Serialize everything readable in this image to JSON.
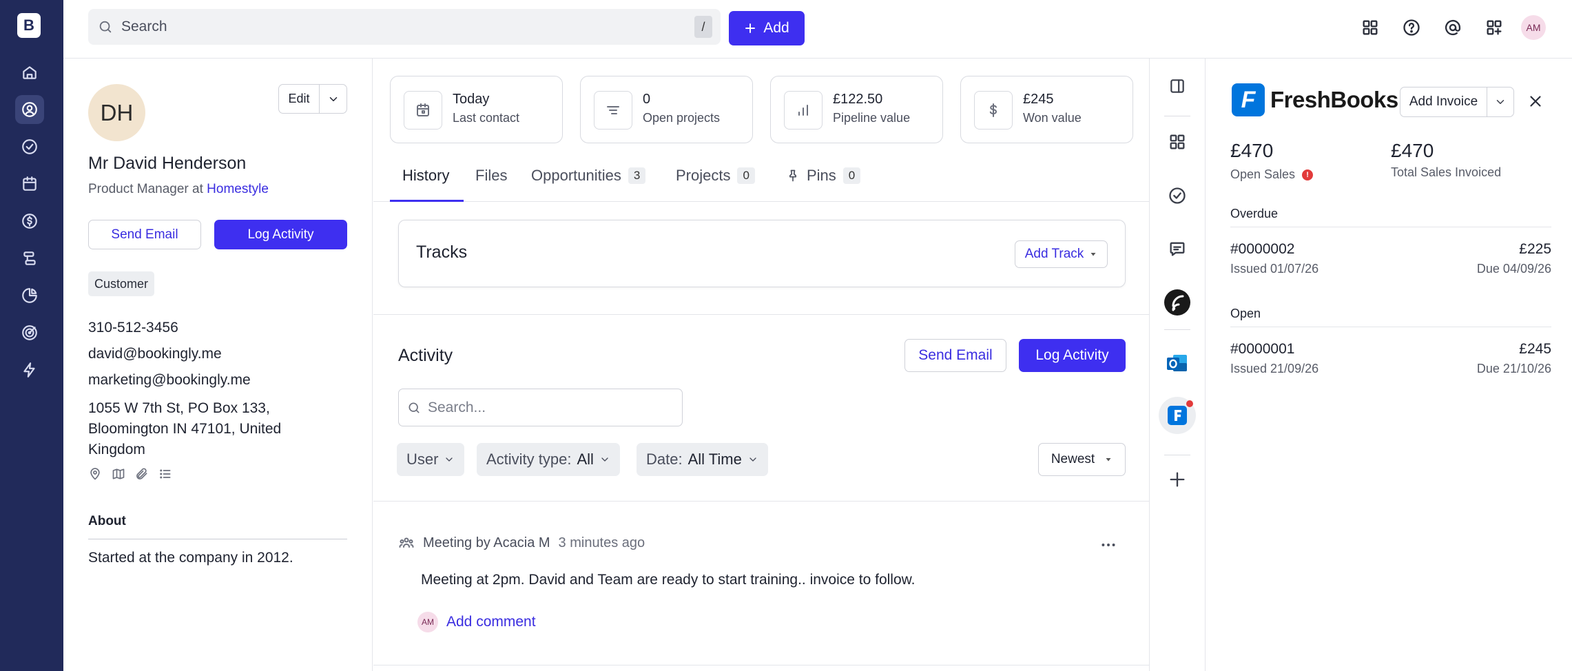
{
  "app": {
    "logo_letter": "B"
  },
  "sidebar": {
    "items": [
      {
        "name": "home-icon"
      },
      {
        "name": "contacts-icon",
        "active": true
      },
      {
        "name": "tasks-icon"
      },
      {
        "name": "calendar-icon"
      },
      {
        "name": "deals-icon"
      },
      {
        "name": "projects-icon"
      },
      {
        "name": "reports-icon"
      },
      {
        "name": "goals-icon"
      },
      {
        "name": "automation-icon"
      }
    ]
  },
  "topbar": {
    "search_placeholder": "Search",
    "search_shortcut": "/",
    "add_label": "Add",
    "user_initials": "AM"
  },
  "contact": {
    "initials": "DH",
    "edit_label": "Edit",
    "name": "Mr David Henderson",
    "title_prefix": "Product Manager at",
    "company": "Homestyle",
    "send_email_label": "Send Email",
    "log_activity_label": "Log Activity",
    "tag": "Customer",
    "phone": "310-512-3456",
    "email_1": "david@bookingly.me",
    "email_2": "marketing@bookingly.me",
    "address": "1055 W 7th St, PO Box 133, Bloomington IN 47101, United Kingdom",
    "about_heading": "About",
    "about_text": "Started at the company in 2012."
  },
  "stats": [
    {
      "value": "Today",
      "label": "Last contact",
      "icon": "calendar-icon"
    },
    {
      "value": "0",
      "label": "Open projects",
      "icon": "list-icon"
    },
    {
      "value": "£122.50",
      "label": "Pipeline value",
      "icon": "bar-chart-icon"
    },
    {
      "value": "£245",
      "label": "Won value",
      "icon": "dollar-icon"
    }
  ],
  "tabs": [
    {
      "label": "History",
      "active": true
    },
    {
      "label": "Files"
    },
    {
      "label": "Opportunities",
      "count": "3"
    },
    {
      "label": "Projects",
      "count": "0"
    },
    {
      "label": "Pins",
      "count": "0"
    }
  ],
  "tracks": {
    "title": "Tracks",
    "add_label": "Add Track"
  },
  "activity": {
    "heading": "Activity",
    "send_email_label": "Send Email",
    "log_activity_label": "Log Activity",
    "search_placeholder": "Search...",
    "filters": {
      "user": "User",
      "type_label": "Activity type:",
      "type_value": "All",
      "date_label": "Date:",
      "date_value": "All Time"
    },
    "sort": "Newest",
    "items": [
      {
        "title": "Meeting by Acacia M",
        "time": "3 minutes ago",
        "body": "Meeting at 2pm. David and Team are ready to start training.. invoice to follow.",
        "commenter_initials": "AM",
        "add_comment_label": "Add comment"
      }
    ]
  },
  "freshbooks": {
    "brand": "FreshBooks",
    "brand_letter": "F",
    "add_invoice_label": "Add Invoice",
    "open_sales_value": "£470",
    "open_sales_label": "Open Sales",
    "alert_glyph": "!",
    "total_invoiced_value": "£470",
    "total_invoiced_label": "Total Sales Invoiced",
    "overdue_heading": "Overdue",
    "open_heading": "Open",
    "overdue": [
      {
        "number": "#0000002",
        "issued": "Issued 01/07/26",
        "amount": "£225",
        "due": "Due 04/09/26"
      }
    ],
    "open": [
      {
        "number": "#0000001",
        "issued": "Issued 21/09/26",
        "amount": "£245",
        "due": "Due 21/10/26"
      }
    ]
  },
  "colors": {
    "sidebar_bg": "#212a5a",
    "accent": "#3e2ff0",
    "link": "#3a2de0",
    "freshbooks_blue": "#0075dd",
    "alert_red": "#e23a3a"
  }
}
